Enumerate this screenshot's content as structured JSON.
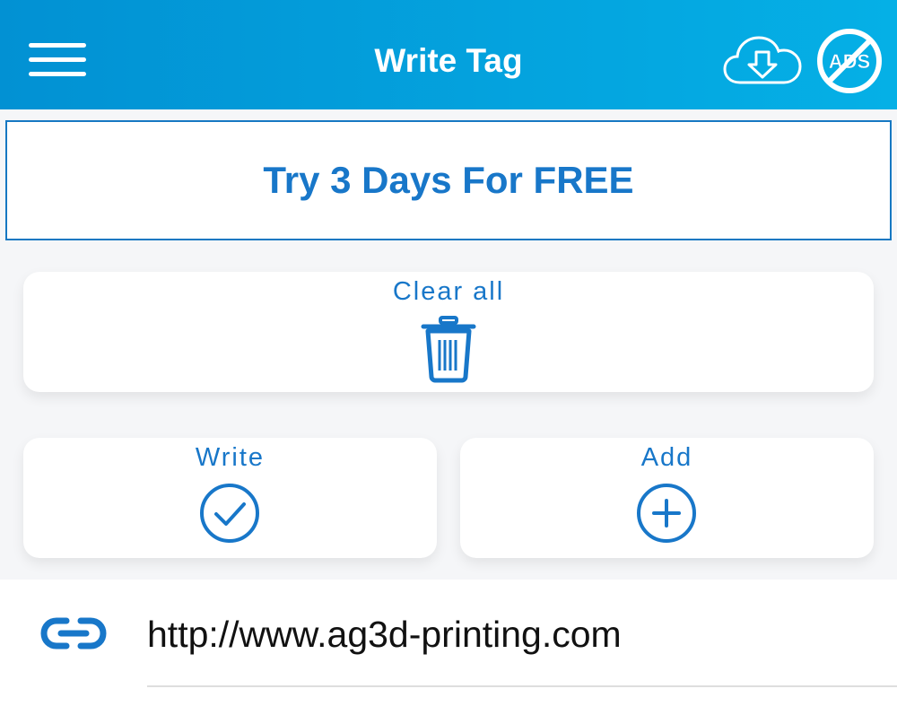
{
  "header": {
    "title": "Write Tag",
    "menu_icon": "hamburger-menu-icon",
    "download_icon": "cloud-download-icon",
    "no_ads_icon": "no-ads-icon",
    "no_ads_text": "ADS"
  },
  "promo": {
    "label": "Try 3 Days For FREE"
  },
  "actions": {
    "clear_all": {
      "label": "Clear all",
      "icon": "trash-icon"
    },
    "write": {
      "label": "Write",
      "icon": "check-circle-icon"
    },
    "add": {
      "label": "Add",
      "icon": "plus-circle-icon"
    }
  },
  "records": [
    {
      "type_icon": "link-icon",
      "value": "http://www.ag3d-printing.com"
    }
  ],
  "colors": {
    "header_gradient_start": "#0291d3",
    "header_gradient_end": "#05b0e6",
    "accent": "#1877c9",
    "background": "#f5f6f8"
  }
}
